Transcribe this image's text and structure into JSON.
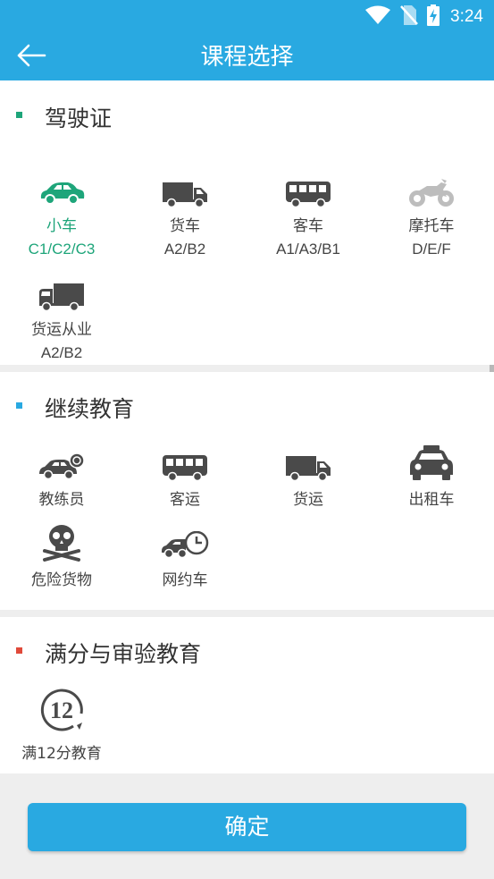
{
  "status_bar": {
    "time": "3:24"
  },
  "header": {
    "title": "课程选择"
  },
  "sections": [
    {
      "title": "驾驶证",
      "marker_color": "#1ea57a",
      "items": [
        {
          "label": "小车",
          "sub": "C1/C2/C3",
          "icon": "car-icon",
          "selected": true
        },
        {
          "label": "货车",
          "sub": "A2/B2",
          "icon": "truck-icon"
        },
        {
          "label": "客车",
          "sub": "A1/A3/B1",
          "icon": "bus-icon"
        },
        {
          "label": "摩托车",
          "sub": "D/E/F",
          "icon": "motorcycle-icon"
        },
        {
          "label": "货运从业",
          "sub": "A2/B2",
          "icon": "cargo-truck-icon"
        }
      ]
    },
    {
      "title": "继续教育",
      "marker_color": "#29a9e1",
      "items": [
        {
          "label": "教练员",
          "icon": "coach-car-icon"
        },
        {
          "label": "客运",
          "icon": "bus-icon"
        },
        {
          "label": "货运",
          "icon": "truck-icon"
        },
        {
          "label": "出租车",
          "icon": "taxi-icon"
        },
        {
          "label": "危险货物",
          "icon": "skull-icon"
        },
        {
          "label": "网约车",
          "icon": "ride-hailing-icon"
        }
      ]
    },
    {
      "title": "满分与审验教育",
      "marker_color": "#e04a3a",
      "items": [
        {
          "label": "满12分教育",
          "icon": "score-12-icon",
          "icon_text": "12"
        }
      ]
    }
  ],
  "footer": {
    "confirm_label": "确定"
  },
  "colors": {
    "primary": "#29a9e1",
    "selected": "#1ea57a",
    "icon": "#4a4a4a",
    "disabled_icon": "#bdbdbd"
  }
}
